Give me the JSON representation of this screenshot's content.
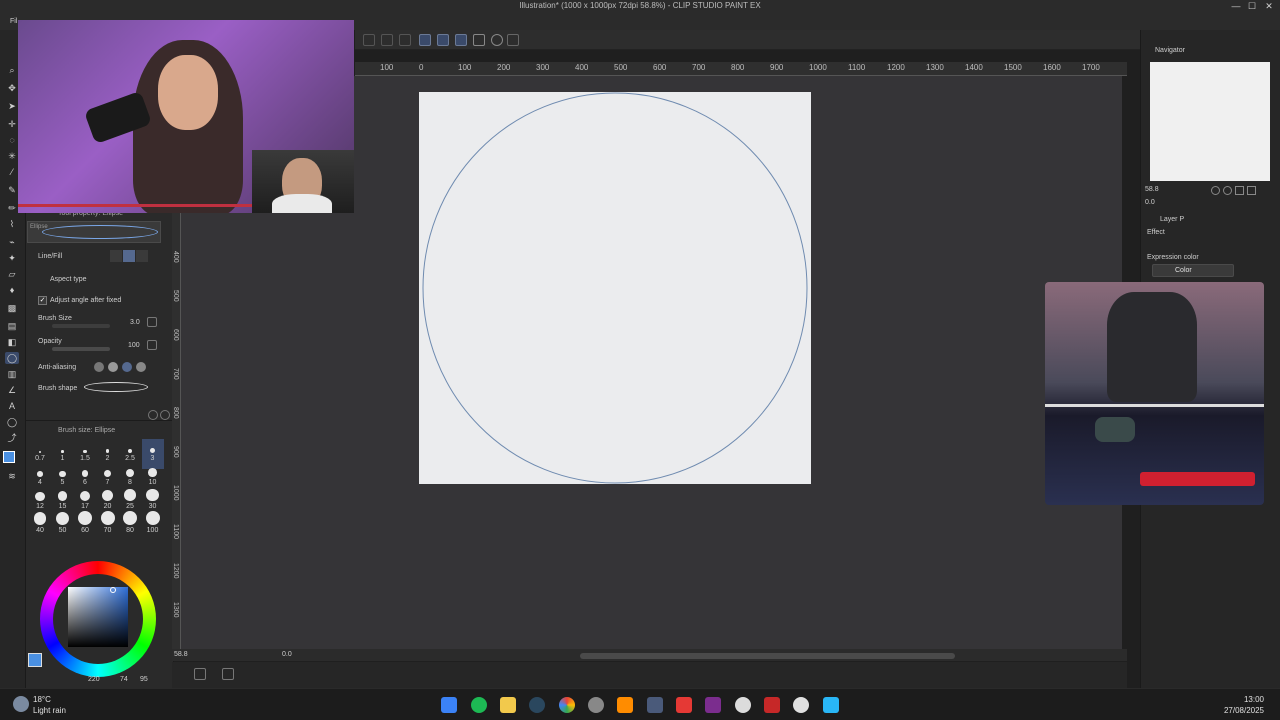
{
  "window": {
    "title": "Illustration* (1000 x 1000px 72dpi 58.8%) - CLIP STUDIO PAINT EX",
    "minimize": "—",
    "maximize": "☐",
    "close": "✕"
  },
  "menu": {
    "file": "Fil"
  },
  "ruler": {
    "top_labels": [
      "100",
      "0",
      "100",
      "200",
      "300",
      "400",
      "500",
      "600",
      "700",
      "800",
      "900",
      "1000",
      "1100",
      "1200",
      "1300",
      "1400",
      "1500",
      "1600",
      "1700"
    ],
    "left_labels": [
      "400",
      "500",
      "600",
      "700",
      "800",
      "900",
      "1000",
      "1100",
      "1200",
      "1300"
    ]
  },
  "tool_property": {
    "header": "Tool property: Ellipse",
    "preset_label": "Ellipse",
    "line_fill_label": "Line/Fill",
    "aspect_type_label": "Aspect type",
    "adjust_angle_label": "Adjust angle after fixed",
    "adjust_angle_checked": true,
    "brush_size_label": "Brush Size",
    "brush_size_value": "3.0",
    "opacity_label": "Opacity",
    "opacity_value": "100",
    "anti_aliasing_label": "Anti-aliasing",
    "brush_shape_label": "Brush shape"
  },
  "brush_size_panel": {
    "header": "Brush size: Ellipse",
    "sizes": [
      "0.7",
      "1",
      "1.5",
      "2",
      "2.5",
      "3",
      "4",
      "5",
      "6",
      "7",
      "8",
      "10",
      "12",
      "15",
      "17",
      "20",
      "25",
      "30",
      "40",
      "50",
      "60",
      "70",
      "80",
      "100"
    ],
    "selected": "3"
  },
  "color_panel": {
    "h": "220",
    "s": "74",
    "v": "95",
    "main_color": "#4a90e2"
  },
  "canvas": {
    "zoom": "58.8",
    "angle": "0.0",
    "paper_color": "#ebecee",
    "ellipse_stroke": "#6f8bb0"
  },
  "navigator": {
    "tab": "Navigator",
    "zoom": "58.8",
    "angle": "0.0"
  },
  "layer_property": {
    "tab": "Layer P",
    "effect_label": "Effect",
    "expression_color_label": "Expression color",
    "expression_color_value": "Color"
  },
  "taskbar": {
    "temperature": "18°C",
    "weather": "Light rain",
    "time": "13:00",
    "date": "27/08/2025"
  }
}
